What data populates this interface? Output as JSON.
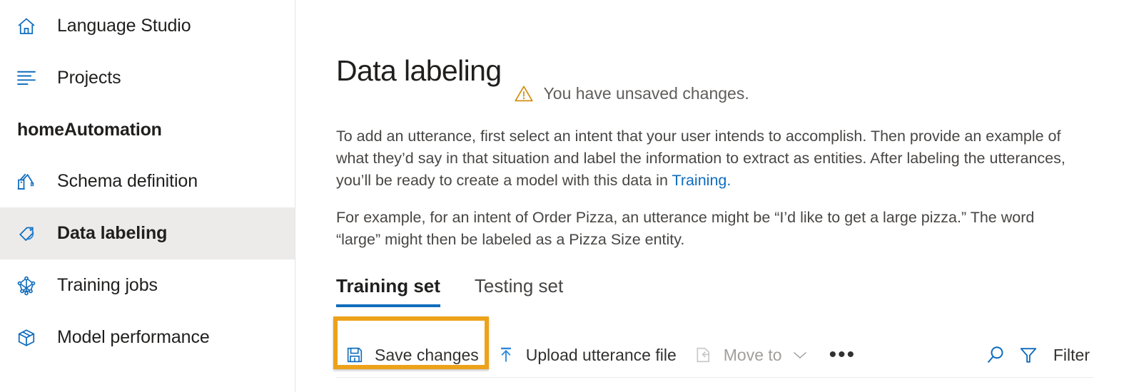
{
  "sidebar": {
    "items": [
      {
        "id": "language-studio",
        "label": "Language Studio",
        "icon": "home-icon",
        "selected": false
      },
      {
        "id": "projects",
        "label": "Projects",
        "icon": "list-icon",
        "selected": false
      }
    ],
    "project_name": "homeAutomation",
    "project_items": [
      {
        "id": "schema-definition",
        "label": "Schema definition",
        "icon": "robot-arm-icon",
        "selected": false
      },
      {
        "id": "data-labeling",
        "label": "Data labeling",
        "icon": "tag-icon",
        "selected": true
      },
      {
        "id": "training-jobs",
        "label": "Training jobs",
        "icon": "network-graph-icon",
        "selected": false
      },
      {
        "id": "model-performance",
        "label": "Model performance",
        "icon": "box-icon",
        "selected": false
      }
    ]
  },
  "main": {
    "page_title": "Data labeling",
    "warning_icon": "warning-triangle-icon",
    "unsaved_message": "You have unsaved changes.",
    "description_1_part1": "To add an utterance, first select an intent that your user intends to accomplish. Then provide an example of what they’d say in that situation and label the information to extract as entities. After labeling the utterances, you’ll be ready to create a model with this data in ",
    "description_1_link": "Training.",
    "description_2": "For example, for an intent of Order Pizza, an utterance might be “I’d like to get a large pizza.” The word “large” might then be labeled as a Pizza Size entity.",
    "tabs": [
      {
        "id": "training-set",
        "label": "Training set",
        "active": true
      },
      {
        "id": "testing-set",
        "label": "Testing set",
        "active": false
      }
    ],
    "toolbar": {
      "save_label": "Save changes",
      "save_icon": "save-floppy-icon",
      "upload_label": "Upload utterance file",
      "upload_icon": "upload-arrow-icon",
      "move_to_label": "Move to",
      "move_to_icon": "move-to-icon",
      "move_to_chevron": "chevron-down-icon",
      "more_label": "•••",
      "more_icon": "more-options-icon",
      "search_icon": "search-icon",
      "filter_icon": "filter-funnel-icon",
      "filter_label": "Filter"
    }
  },
  "colors": {
    "accent_blue": "#0f6cbd",
    "highlight_orange": "#eda21a",
    "warning_amber": "#d18f13",
    "selected_row": "#edebe9",
    "text_primary": "#201f1e",
    "text_secondary": "#605e5c",
    "disabled": "#a19f9d"
  }
}
